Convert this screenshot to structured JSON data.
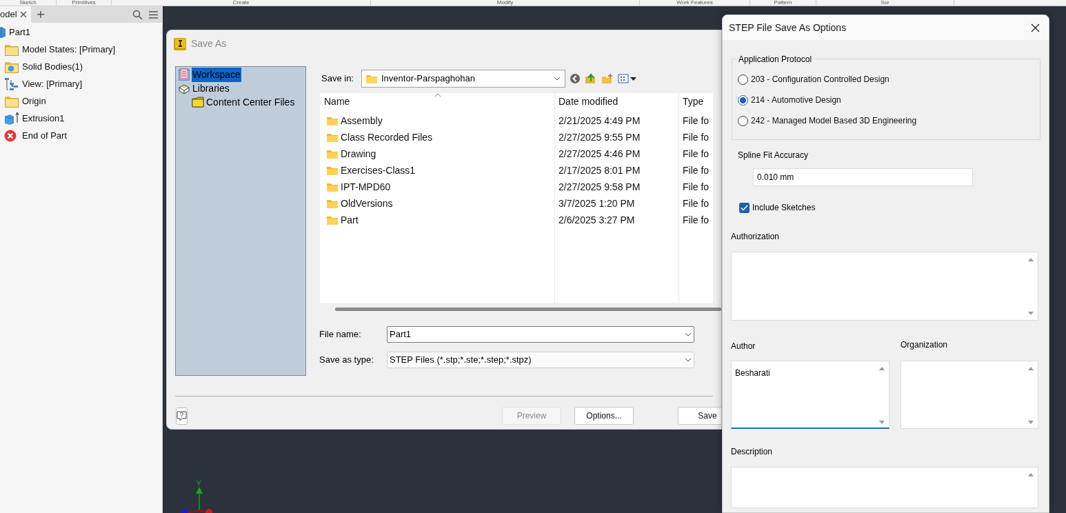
{
  "ribbon_tabs": [
    "Sketch",
    "Primitives",
    "Create",
    "Modify",
    "Work Features",
    "Pattern",
    "Sur"
  ],
  "browser": {
    "tab": "odel",
    "tree": [
      {
        "label": "Part1",
        "kind": "part",
        "children": [
          {
            "label": "Model States: [Primary]",
            "kind": "folder"
          },
          {
            "label": "Solid Bodies(1)",
            "kind": "bodies"
          },
          {
            "label": "View: [Primary]",
            "kind": "view"
          },
          {
            "label": "Origin",
            "kind": "folder"
          },
          {
            "label": "Extrusion1",
            "kind": "extrusion"
          },
          {
            "label": "End of Part",
            "kind": "end"
          }
        ]
      }
    ]
  },
  "save_as": {
    "title": "Save As",
    "places": [
      {
        "label": "Workspace",
        "kind": "workspace",
        "selected": true
      },
      {
        "label": "Libraries",
        "kind": "libraries",
        "selected": false,
        "children": [
          {
            "label": "Content Center Files",
            "kind": "folder",
            "selected": false
          }
        ]
      }
    ],
    "save_in_label": "Save in:",
    "save_in": "Inventor-Parspaghohan",
    "columns": [
      "Name",
      "Date modified",
      "Type"
    ],
    "rows": [
      {
        "name": "Assembly",
        "date": "2/21/2025 4:49 PM",
        "type": "File fo"
      },
      {
        "name": "Class Recorded Files",
        "date": "2/27/2025 9:55 PM",
        "type": "File fo"
      },
      {
        "name": "Drawing",
        "date": "2/27/2025 4:46 PM",
        "type": "File fo"
      },
      {
        "name": "Exercises-Class1",
        "date": "2/17/2025 8:01 PM",
        "type": "File fo"
      },
      {
        "name": "IPT-MPD60",
        "date": "2/27/2025 9:58 PM",
        "type": "File fo"
      },
      {
        "name": "OldVersions",
        "date": "3/7/2025 1:20 PM",
        "type": "File fo"
      },
      {
        "name": "Part",
        "date": "2/6/2025 3:27 PM",
        "type": "File fo"
      }
    ],
    "file_name_label": "File name:",
    "file_name": "Part1",
    "type_label": "Save as type:",
    "type": "STEP Files (*.stp;*.ste;*.step;*.stpz)",
    "buttons": [
      {
        "label": "Preview",
        "disabled": true
      },
      {
        "label": "Options...",
        "disabled": false
      },
      {
        "label": "Save",
        "disabled": false
      }
    ]
  },
  "step_options": {
    "title": "STEP File Save As Options",
    "protocol_label": "Application Protocol",
    "protocols": [
      {
        "label": "203 - Configuration Controlled Design",
        "selected": false
      },
      {
        "label": "214 - Automotive Design",
        "selected": true
      },
      {
        "label": "242 - Managed Model Based 3D Engineering",
        "selected": false
      }
    ],
    "spline_label": "Spline Fit Accuracy",
    "spline_value": "0.010 mm",
    "include_sketches": {
      "label": "Include Sketches",
      "checked": true
    },
    "authorization_label": "Authorization",
    "author_label": "Author",
    "author": "Besharati",
    "organization_label": "Organization",
    "description_label": "Description"
  },
  "triad": {
    "y_label": "Y"
  }
}
